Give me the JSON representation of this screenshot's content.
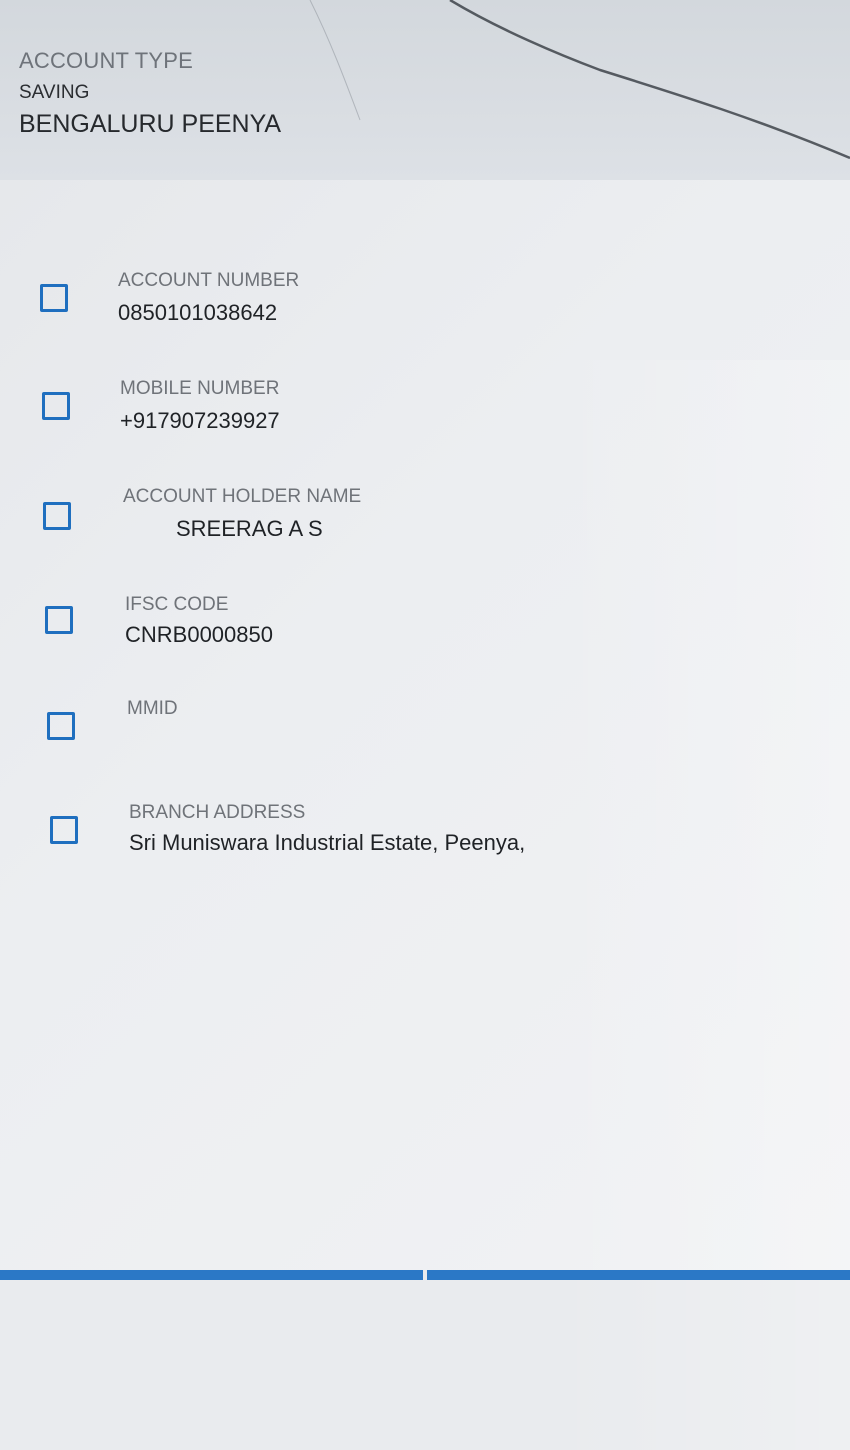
{
  "header": {
    "account_type_label": "ACCOUNT TYPE",
    "account_type_value": "SAVING",
    "branch_name": "BENGALURU PEENYA"
  },
  "fields": [
    {
      "label": "ACCOUNT NUMBER",
      "value": "0850101038642",
      "checked": false
    },
    {
      "label": "MOBILE NUMBER",
      "value": "+917907239927",
      "checked": false
    },
    {
      "label": "ACCOUNT HOLDER NAME",
      "value": "SREERAG A S",
      "checked": false
    },
    {
      "label": "IFSC CODE",
      "value": "CNRB0000850",
      "checked": false
    },
    {
      "label": "MMID",
      "value": "",
      "checked": false
    },
    {
      "label": "BRANCH ADDRESS",
      "value": "Sri Muniswara Industrial Estate, Peenya,",
      "checked": false
    }
  ],
  "colors": {
    "checkbox_border": "#1f6fbf",
    "header_bg": "#d6dadf",
    "content_bg": "#eceef1",
    "footer_accent": "#2b78c6"
  },
  "icons": {
    "checkbox": "checkbox-unchecked-icon"
  }
}
